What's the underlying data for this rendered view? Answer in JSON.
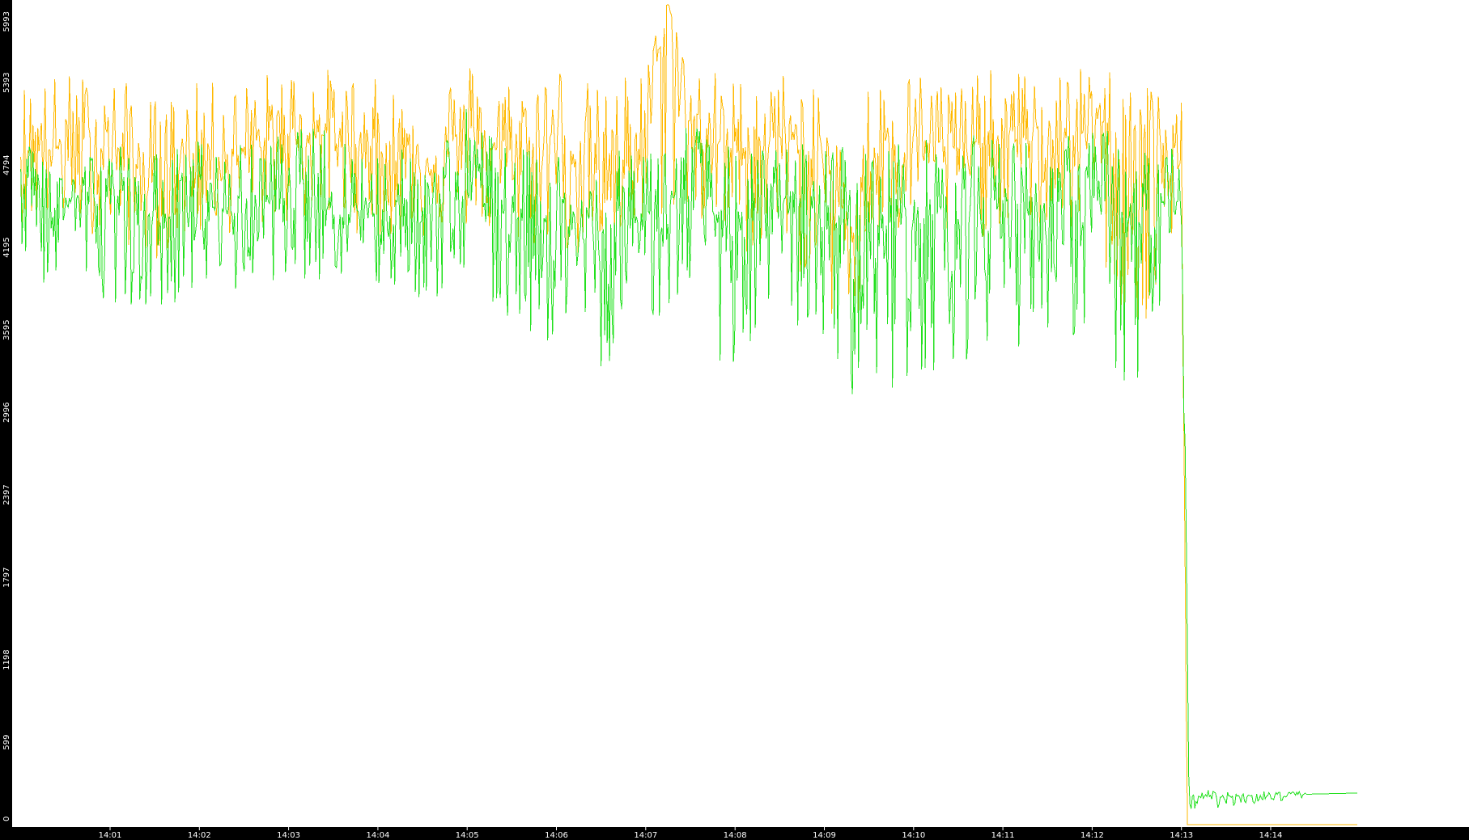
{
  "chart_data": {
    "type": "line",
    "title": "",
    "xlabel": "",
    "ylabel": "",
    "ylim": [
      0,
      5993
    ],
    "yticks": [
      0,
      599,
      1198,
      1797,
      2397,
      2996,
      3595,
      4195,
      4794,
      5393,
      5993
    ],
    "ytick_labels": [
      "0",
      "599",
      "1198",
      "1797",
      "2397",
      "2996",
      "3595",
      "4195",
      "4794",
      "5393",
      "5993"
    ],
    "xlim": [
      "14:00:00",
      "14:14:59"
    ],
    "xticks": [
      "14:01",
      "14:02",
      "14:03",
      "14:04",
      "14:05",
      "14:06",
      "14:07",
      "14:08",
      "14:09",
      "14:10",
      "14:11",
      "14:12",
      "14:13",
      "14:14"
    ],
    "grid": false,
    "series": [
      {
        "color": "#ffb800",
        "x": [
          "14:00:00",
          "14:00:30",
          "14:01:00",
          "14:01:30",
          "14:02:00",
          "14:02:30",
          "14:03:00",
          "14:03:30",
          "14:04:00",
          "14:04:30",
          "14:05:00",
          "14:05:30",
          "14:06:00",
          "14:06:30",
          "14:07:00",
          "14:07:15",
          "14:07:30",
          "14:08:00",
          "14:08:30",
          "14:09:00",
          "14:09:20",
          "14:09:30",
          "14:10:00",
          "14:10:30",
          "14:11:00",
          "14:11:30",
          "14:12:00",
          "14:12:30",
          "14:13:00",
          "14:13:04",
          "14:13:05",
          "14:14:59"
        ],
        "y": [
          4950,
          4900,
          4950,
          4650,
          4900,
          4850,
          5050,
          5000,
          4900,
          4800,
          5000,
          4850,
          5000,
          4700,
          4950,
          5993,
          5050,
          4900,
          5000,
          4800,
          4300,
          4850,
          5000,
          4900,
          5000,
          4950,
          5050,
          5000,
          4850,
          0,
          0,
          0
        ],
        "y_min": [
          4300,
          4350,
          4250,
          4100,
          4250,
          4300,
          4350,
          4350,
          4250,
          4250,
          4300,
          4150,
          4200,
          3950,
          4250,
          4400,
          4350,
          4100,
          4200,
          3750,
          3350,
          4100,
          4300,
          4150,
          4350,
          4200,
          4350,
          3100,
          4150,
          0,
          0,
          0
        ],
        "y_max": [
          5420,
          5480,
          5460,
          5300,
          5400,
          5420,
          5530,
          5500,
          5420,
          5330,
          5580,
          5450,
          5580,
          5350,
          5600,
          5993,
          5550,
          5450,
          5500,
          5300,
          4700,
          5450,
          5500,
          5450,
          5500,
          5450,
          5520,
          5500,
          5250,
          0,
          0,
          0
        ]
      },
      {
        "color": "#22e01e",
        "x": [
          "14:00:00",
          "14:00:30",
          "14:01:00",
          "14:01:30",
          "14:02:00",
          "14:02:30",
          "14:03:00",
          "14:03:30",
          "14:04:00",
          "14:04:30",
          "14:05:00",
          "14:05:30",
          "14:06:00",
          "14:06:30",
          "14:07:00",
          "14:07:30",
          "14:08:00",
          "14:08:30",
          "14:09:00",
          "14:09:30",
          "14:10:00",
          "14:10:30",
          "14:11:00",
          "14:11:30",
          "14:12:00",
          "14:12:30",
          "14:13:00",
          "14:13:03",
          "14:13:05",
          "14:14:59"
        ],
        "y": [
          4500,
          4550,
          4500,
          4350,
          4500,
          4450,
          4600,
          4550,
          4450,
          4400,
          4600,
          4450,
          4400,
          4150,
          4450,
          4550,
          4350,
          4450,
          4400,
          4300,
          4450,
          4400,
          4550,
          4450,
          4550,
          4350,
          4400,
          2400,
          200,
          230
        ],
        "y_min": [
          3900,
          3900,
          3800,
          3750,
          3850,
          3850,
          4000,
          3900,
          3850,
          3800,
          3800,
          3600,
          3450,
          3300,
          3600,
          3800,
          3150,
          3700,
          3400,
          2950,
          3250,
          3350,
          3500,
          3400,
          3600,
          2900,
          3650,
          1500,
          100,
          230
        ],
        "y_max": [
          5050,
          4850,
          5000,
          4900,
          5000,
          4950,
          5050,
          5100,
          4950,
          4900,
          5250,
          4900,
          4950,
          4800,
          5050,
          5150,
          4900,
          4950,
          5000,
          4950,
          5000,
          5000,
          5050,
          4950,
          5100,
          5000,
          4950,
          2600,
          250,
          250
        ]
      }
    ]
  },
  "colors": {
    "axis_bar": "#000000",
    "tick_text": "#ffffff",
    "background": "#ffffff"
  }
}
